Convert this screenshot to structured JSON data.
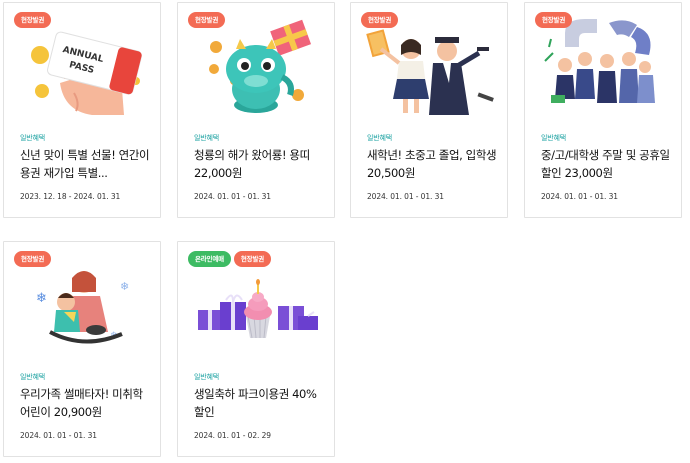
{
  "cards": [
    {
      "badges": [
        {
          "text": "현장발권",
          "color": "orange"
        }
      ],
      "category": "일반혜택",
      "title": "신년 맞이 특별 선물! 연간이용권 재가입 특별...",
      "date": "2023. 12. 18 - 2024. 01. 31",
      "image": "annual-pass-ticket-illustration",
      "image_text": "ANNUAL PASS"
    },
    {
      "badges": [
        {
          "text": "현장발권",
          "color": "orange"
        }
      ],
      "category": "일반혜택",
      "title": "청룡의 해가 왔어룡! 용띠 22,000원",
      "date": "2024. 01. 01 - 01. 31",
      "image": "blue-dragon-illustration"
    },
    {
      "badges": [
        {
          "text": "현장발권",
          "color": "orange"
        }
      ],
      "category": "일반혜택",
      "title": "새학년! 초중고 졸업, 입학생 20,500원",
      "date": "2024. 01. 01 - 01. 31",
      "image": "graduation-students-illustration"
    },
    {
      "badges": [
        {
          "text": "현장발권",
          "color": "orange"
        }
      ],
      "category": "일반혜택",
      "title": "중/고/대학생 주말 및 공휴일 할인 23,000원",
      "date": "2024. 01. 01 - 01. 31",
      "image": "students-group-illustration"
    },
    {
      "badges": [
        {
          "text": "현장발권",
          "color": "orange"
        }
      ],
      "category": "일반혜택",
      "title": "우리가족 썰매타자! 미취학 어린이 20,900원",
      "date": "2024. 01. 01 - 01. 31",
      "image": "family-sled-illustration"
    },
    {
      "badges": [
        {
          "text": "온라인예매",
          "color": "green"
        },
        {
          "text": "현장발권",
          "color": "orange"
        }
      ],
      "category": "일반혜택",
      "title": "생일축하 파크이용권 40%할인",
      "date": "2024. 01. 01 - 02. 29",
      "image": "birthday-cake-gifts-illustration"
    }
  ]
}
